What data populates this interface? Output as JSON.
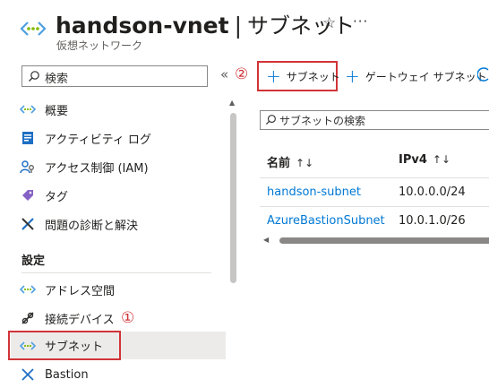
{
  "header": {
    "title": "handson-vnet",
    "separator": "|",
    "page": "サブネット",
    "subtitle": "仮想ネットワーク",
    "star_icon": "star-icon",
    "more_label": "···"
  },
  "sidebar": {
    "search_placeholder": "検索",
    "collapse_label": "«",
    "items_top": [
      {
        "label": "概要",
        "icon": "vnet-icon"
      },
      {
        "label": "アクティビティ ログ",
        "icon": "activity-log-icon"
      },
      {
        "label": "アクセス制御 (IAM)",
        "icon": "iam-icon"
      },
      {
        "label": "タグ",
        "icon": "tag-icon"
      },
      {
        "label": "問題の診断と解決",
        "icon": "diagnose-icon"
      }
    ],
    "section_label": "設定",
    "items_settings": [
      {
        "label": "アドレス空間",
        "icon": "address-space-icon"
      },
      {
        "label": "接続デバイス",
        "icon": "connected-devices-icon"
      },
      {
        "label": "サブネット",
        "icon": "subnet-icon"
      },
      {
        "label": "Bastion",
        "icon": "bastion-icon"
      }
    ]
  },
  "annotations": {
    "marker_1": "①",
    "marker_2": "②",
    "color": "#d13438"
  },
  "toolbar": {
    "add_subnet": "サブネット",
    "add_gateway_subnet": "ゲートウェイ サブネット"
  },
  "main": {
    "search_placeholder": "サブネットの検索",
    "columns": [
      "名前",
      "IPv4"
    ],
    "sort_glyph": "↑↓",
    "rows": [
      {
        "name": "handson-subnet",
        "ipv4": "10.0.0.0/24"
      },
      {
        "name": "AzureBastionSubnet",
        "ipv4": "10.0.1.0/26"
      }
    ]
  },
  "colors": {
    "accent": "#0078d4",
    "selected_bg": "#edebe9",
    "highlight": "#d13438"
  }
}
